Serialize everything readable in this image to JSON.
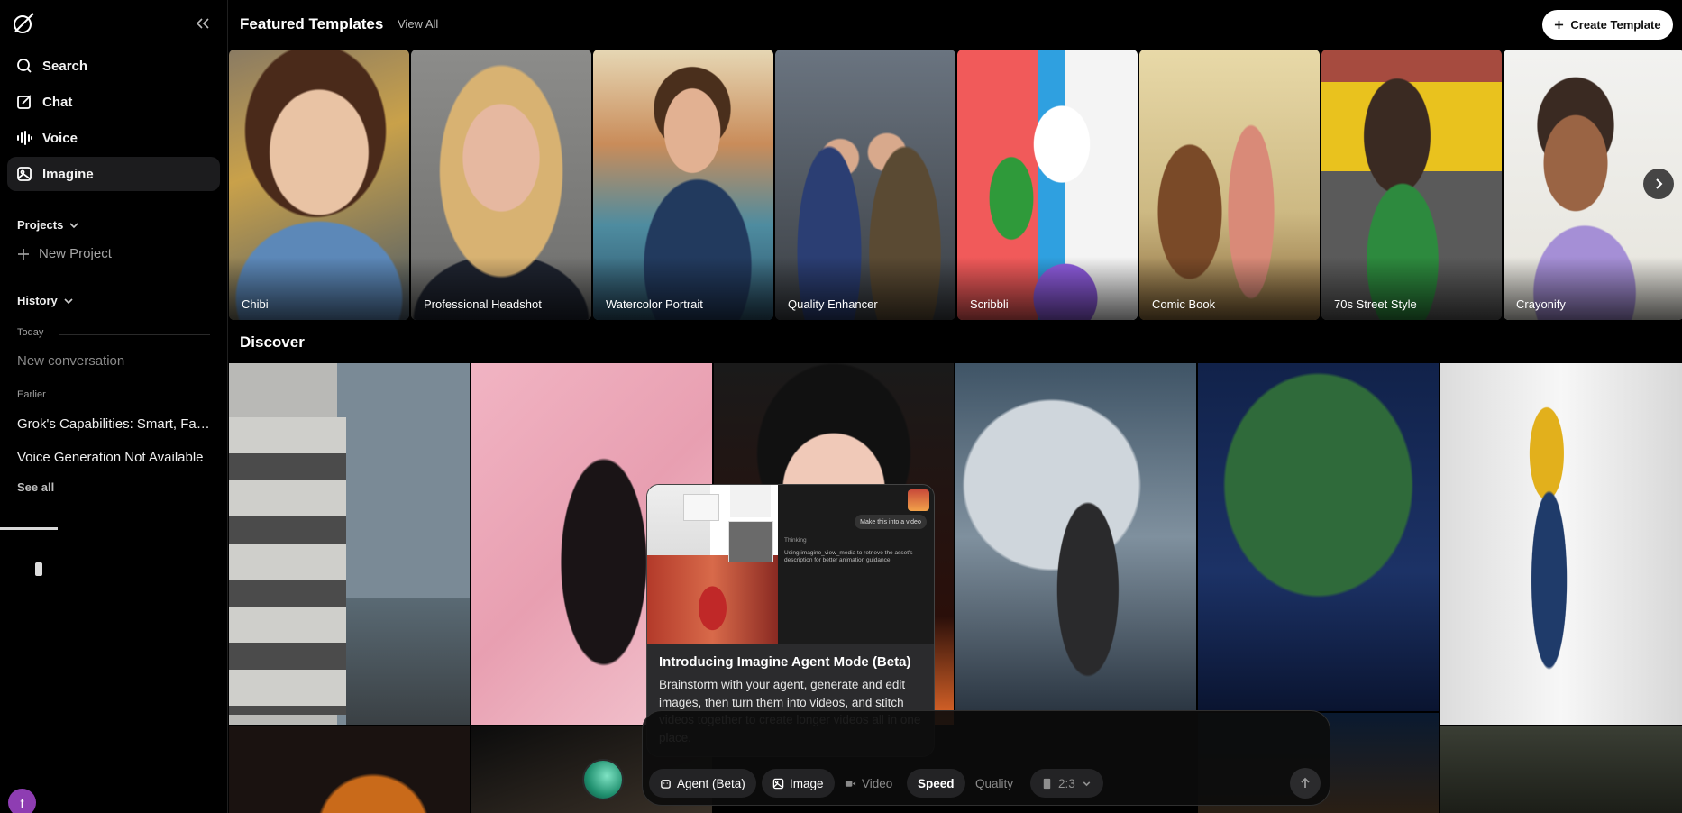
{
  "sidebar": {
    "nav": [
      {
        "label": "Search",
        "icon": "search-icon"
      },
      {
        "label": "Chat",
        "icon": "edit-icon"
      },
      {
        "label": "Voice",
        "icon": "waveform-icon"
      },
      {
        "label": "Imagine",
        "icon": "image-icon",
        "active": true
      }
    ],
    "projects_label": "Projects",
    "new_project_label": "New Project",
    "history_label": "History",
    "today_label": "Today",
    "today_items": [
      "New conversation"
    ],
    "earlier_label": "Earlier",
    "earlier_items": [
      "Grok's Capabilities: Smart, Fast…",
      "Voice Generation Not Available"
    ],
    "see_all_label": "See all",
    "avatar_initial": "f"
  },
  "header": {
    "featured_title": "Featured Templates",
    "view_all_label": "View All",
    "create_label": "Create Template"
  },
  "templates": [
    {
      "label": "Chibi"
    },
    {
      "label": "Professional Headshot"
    },
    {
      "label": "Watercolor Portrait"
    },
    {
      "label": "Quality Enhancer"
    },
    {
      "label": "Scribbli"
    },
    {
      "label": "Comic Book"
    },
    {
      "label": "70s Street Style"
    },
    {
      "label": "Crayonify"
    }
  ],
  "discover_title": "Discover",
  "popup": {
    "title": "Introducing Imagine Agent Mode (Beta)",
    "body": "Brainstorm with your agent, generate and edit images, then turn them into videos, and stitch videos together to create longer videos all in one place.",
    "preview_message": "Make this into a video",
    "preview_thinking": "Thinking",
    "preview_text": "Using imagine_view_media to retrieve the asset's description for better animation guidance."
  },
  "composer": {
    "agent_label": "Agent (Beta)",
    "image_label": "Image",
    "video_label": "Video",
    "speed_label": "Speed",
    "quality_label": "Quality",
    "ratio_label": "2:3"
  },
  "colors": {
    "background": "#000000",
    "active_nav": "#1c1c1e",
    "avatar": "#8e3db2",
    "popup": "#2b2b2d"
  }
}
